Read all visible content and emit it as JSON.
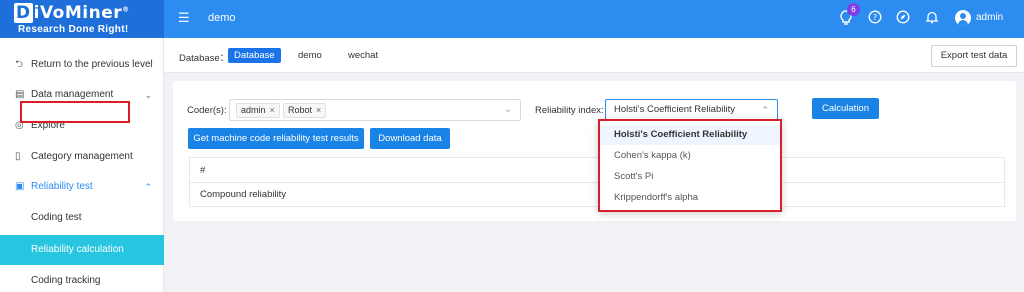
{
  "header": {
    "logo_title": "iVoMiner",
    "logo_letter": "D",
    "logo_trademark": "®",
    "logo_sub": "Research Done Right!",
    "app_name": "demo",
    "notification_count": "6",
    "username": "admin"
  },
  "sidebar": {
    "items": [
      {
        "label": "Return to the previous level",
        "icon": "return-icon"
      },
      {
        "label": "Data management",
        "icon": "document-icon"
      },
      {
        "label": "Explore",
        "icon": "compass-icon"
      },
      {
        "label": "Category management",
        "icon": "bookmark-icon"
      },
      {
        "label": "Reliability test",
        "icon": "checklist-icon"
      },
      {
        "label": "Coding test"
      },
      {
        "label": "Reliability calculation"
      },
      {
        "label": "Coding tracking"
      }
    ]
  },
  "database_bar": {
    "label": "Database：",
    "tabs": [
      "Database",
      "demo",
      "wechat"
    ],
    "active_tab": "Database",
    "export_label": "Export test data"
  },
  "form": {
    "coders_label": "Coder(s):",
    "coder_tags": [
      "admin",
      "Robot"
    ],
    "reliability_label": "Reliability index:",
    "reliability_value": "Holsti's Coefficient Reliability",
    "calculation_label": "Calculation",
    "machine_test_label": "Get machine code reliability test results",
    "download_label": "Download data"
  },
  "table": {
    "header": "#",
    "rows": [
      "Compound reliability"
    ]
  },
  "dropdown": {
    "options": [
      "Holsti's Coefficient Reliability",
      "Cohen's kappa (k)",
      "Scott's Pi",
      "Krippendorff's alpha"
    ],
    "selected": "Holsti's Coefficient Reliability"
  },
  "colors": {
    "topbar": "#2d8cf0",
    "active_sidebar": "#27c5e0",
    "primary_button": "#1a84e6",
    "highlight_border": "#d9202a"
  }
}
